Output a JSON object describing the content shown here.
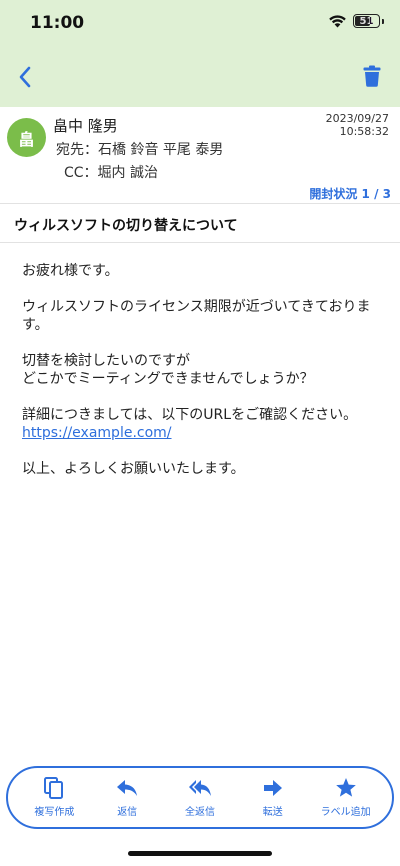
{
  "status_bar": {
    "time": "11:00",
    "battery": "51"
  },
  "colors": {
    "accent": "#2f6fdc",
    "header_bg": "#dff0d4",
    "avatar_bg": "#7bbd4a"
  },
  "nav": {
    "back_icon": "chevron-left-icon",
    "delete_icon": "trash-icon"
  },
  "message": {
    "avatar_initial": "畠",
    "sender": "畠中 隆男",
    "date": "2023/09/27",
    "time": "10:58:32",
    "to": "宛先：石橋 鈴音 平尾 泰男",
    "cc": "CC：堀内 誠治",
    "open_status": "開封状況 1 / 3",
    "subject": "ウィルスソフトの切り替えについて",
    "body": {
      "greeting": "お疲れ様です。",
      "p1": "ウィルスソフトのライセンス期限が近づいてきております。",
      "p2_line1": "切替を検討したいのですが",
      "p2_line2": "どこかでミーティングできませんでしょうか？",
      "p3": "詳細につきましては、以下のURLをご確認ください。",
      "link": "https://example.com/",
      "closing": "以上、よろしくお願いいたします。"
    }
  },
  "toolbar": {
    "items": [
      {
        "label": "複写作成",
        "icon": "copy-icon"
      },
      {
        "label": "返信",
        "icon": "reply-icon"
      },
      {
        "label": "全返信",
        "icon": "reply-all-icon"
      },
      {
        "label": "転送",
        "icon": "forward-icon"
      },
      {
        "label": "ラベル追加",
        "icon": "star-icon"
      }
    ]
  }
}
